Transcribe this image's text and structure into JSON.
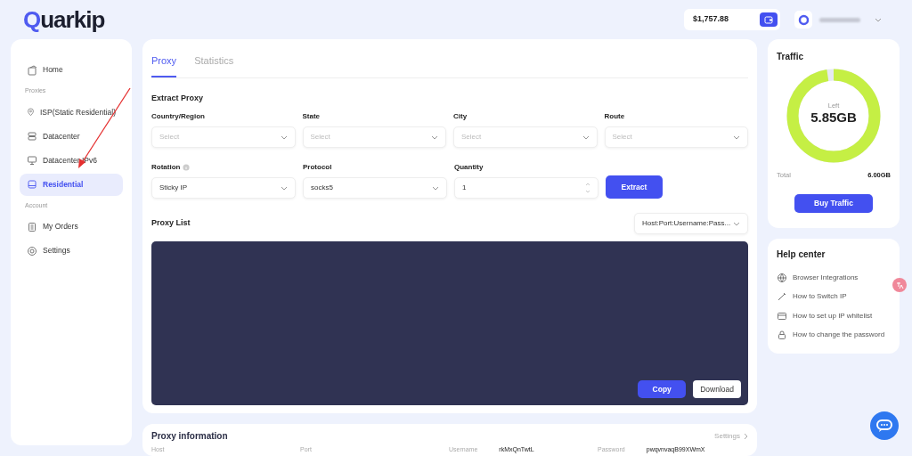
{
  "logo": {
    "text": "Quarkip"
  },
  "header": {
    "balance": "$1,757.88"
  },
  "sidebar": {
    "sections": [
      {
        "items": [
          {
            "label": "Home",
            "selected": false
          }
        ]
      },
      {
        "heading": "Proxies",
        "items": [
          {
            "label": "ISP(Static Residential)",
            "selected": false
          },
          {
            "label": "Datacenter",
            "selected": false
          },
          {
            "label": "Datacenter IPv6",
            "selected": false
          },
          {
            "label": "Residential",
            "selected": true
          }
        ]
      },
      {
        "heading": "Account",
        "items": [
          {
            "label": "My Orders",
            "selected": false
          },
          {
            "label": "Settings",
            "selected": false
          }
        ]
      }
    ]
  },
  "tabs": [
    {
      "label": "Proxy",
      "selected": true
    },
    {
      "label": "Statistics",
      "selected": false
    }
  ],
  "extract": {
    "title": "Extract Proxy",
    "rows": [
      [
        {
          "label": "Country/Region",
          "kind": "select",
          "placeholder": "Select"
        },
        {
          "label": "State",
          "kind": "select",
          "placeholder": "Select"
        },
        {
          "label": "City",
          "kind": "select",
          "placeholder": "Select"
        },
        {
          "label": "Route",
          "kind": "select",
          "placeholder": "Select"
        }
      ],
      [
        {
          "label": "Rotation",
          "kind": "select",
          "info": true,
          "value": "Sticky IP"
        },
        {
          "label": "Protocol",
          "kind": "select",
          "value": "socks5"
        },
        {
          "label": "Quantity",
          "kind": "number",
          "value": "1"
        }
      ]
    ],
    "button": "Extract"
  },
  "proxy_list": {
    "title": "Proxy List",
    "format": "Host:Port:Username:Pass...",
    "buttons": [
      "Copy",
      "Download"
    ]
  },
  "traffic": {
    "title": "Traffic",
    "left_label": "Left",
    "left_value": "5.85GB",
    "level": 0.975,
    "total_label": "Total",
    "total_value": "6.00GB",
    "button": "Buy Traffic"
  },
  "help": {
    "title": "Help center",
    "items": [
      "Browser Integrations",
      "How to Switch IP",
      "How to set up IP whitelist",
      "How to change the password"
    ]
  },
  "proxy_info": {
    "title": "Proxy information",
    "settings": "Settings",
    "fields": [
      {
        "label": "Host"
      },
      {
        "label": "Port"
      },
      {
        "label": "Username",
        "value": "rkMxQnTwtL"
      },
      {
        "label": "Password",
        "value": "pwqvnvaqB99XWmX"
      }
    ]
  }
}
